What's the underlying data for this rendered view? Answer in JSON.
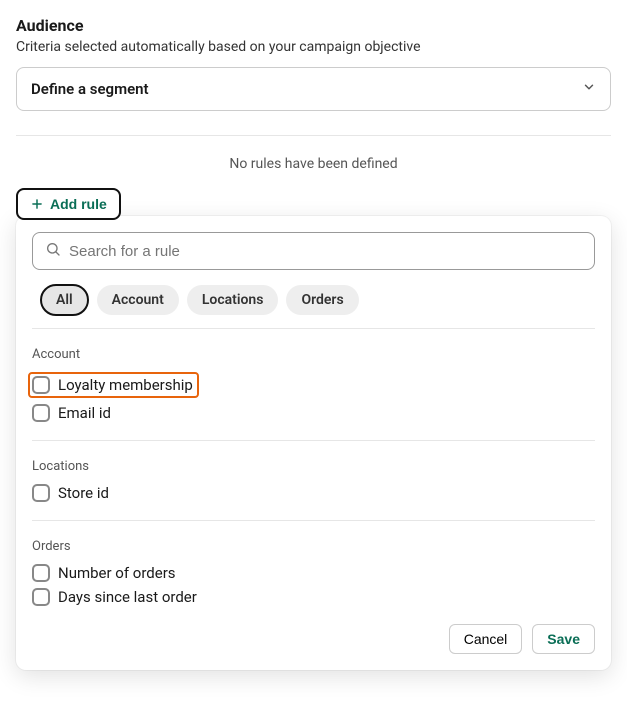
{
  "header": {
    "title": "Audience",
    "subtitle": "Criteria selected automatically based on your campaign objective"
  },
  "segment": {
    "label": "Define a segment"
  },
  "rules_empty": "No rules have been defined",
  "add_rule_label": "Add rule",
  "search": {
    "placeholder": "Search for a rule"
  },
  "filters": [
    "All",
    "Account",
    "Locations",
    "Orders"
  ],
  "active_filter": "All",
  "groups": [
    {
      "name": "Account",
      "items": [
        {
          "label": "Loyalty membership",
          "highlighted": true
        },
        {
          "label": "Email id",
          "highlighted": false
        }
      ]
    },
    {
      "name": "Locations",
      "items": [
        {
          "label": "Store id",
          "highlighted": false
        }
      ]
    },
    {
      "name": "Orders",
      "items": [
        {
          "label": "Number of orders",
          "highlighted": false
        },
        {
          "label": "Days since last order",
          "highlighted": false
        }
      ]
    }
  ],
  "footer": {
    "cancel": "Cancel",
    "save": "Save"
  }
}
